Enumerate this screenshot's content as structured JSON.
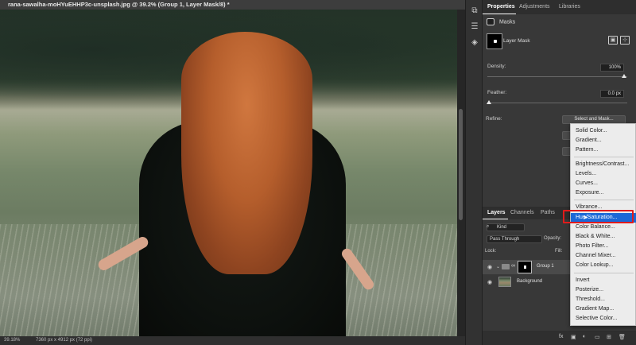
{
  "document": {
    "title": "rana-sawalha-moHYuEHHP3c-unsplash.jpg @ 39.2% (Group 1, Layer Mask/8) *"
  },
  "status_bar": {
    "zoom": "39.18%",
    "dimensions": "7360 px x 4912 px (72 ppi)"
  },
  "properties_panel": {
    "tabs": [
      "Properties",
      "Adjustments",
      "Libraries"
    ],
    "masks_label": "Masks",
    "layer_mask_label": "Layer Mask",
    "density": {
      "label": "Density:",
      "value": "100%",
      "level": 1.0
    },
    "feather": {
      "label": "Feather:",
      "value": "0.0 px",
      "level": 0.0
    },
    "refine_label": "Refine:",
    "select_mask_button": "Select and Mask..."
  },
  "layers_panel": {
    "tabs": [
      "Layers",
      "Channels",
      "Paths"
    ],
    "kind_filter": "Kind",
    "blend_mode": "Pass Through",
    "opacity_label": "Opacity:",
    "lock_label": "Lock:",
    "fill_label": "Fill:",
    "layers": [
      {
        "name": "Group 1",
        "selected": true
      },
      {
        "name": "Background",
        "selected": false
      }
    ]
  },
  "adjustment_menu": {
    "items": [
      "Solid Color...",
      "Gradient...",
      "Pattern...",
      "Brightness/Contrast...",
      "Levels...",
      "Curves...",
      "Exposure...",
      "Vibrance...",
      "Hue/Saturation...",
      "Color Balance...",
      "Black & White...",
      "Photo Filter...",
      "Channel Mixer...",
      "Color Lookup...",
      "Invert",
      "Posterize...",
      "Threshold...",
      "Gradient Map...",
      "Selective Color..."
    ],
    "hovered": "Hue/Saturation...",
    "highlight_color": "#e01b1b",
    "hover_color": "#1b68d6"
  },
  "icons": {
    "eye": "eye-icon",
    "folder": "folder-icon",
    "chain": "chain-icon"
  }
}
